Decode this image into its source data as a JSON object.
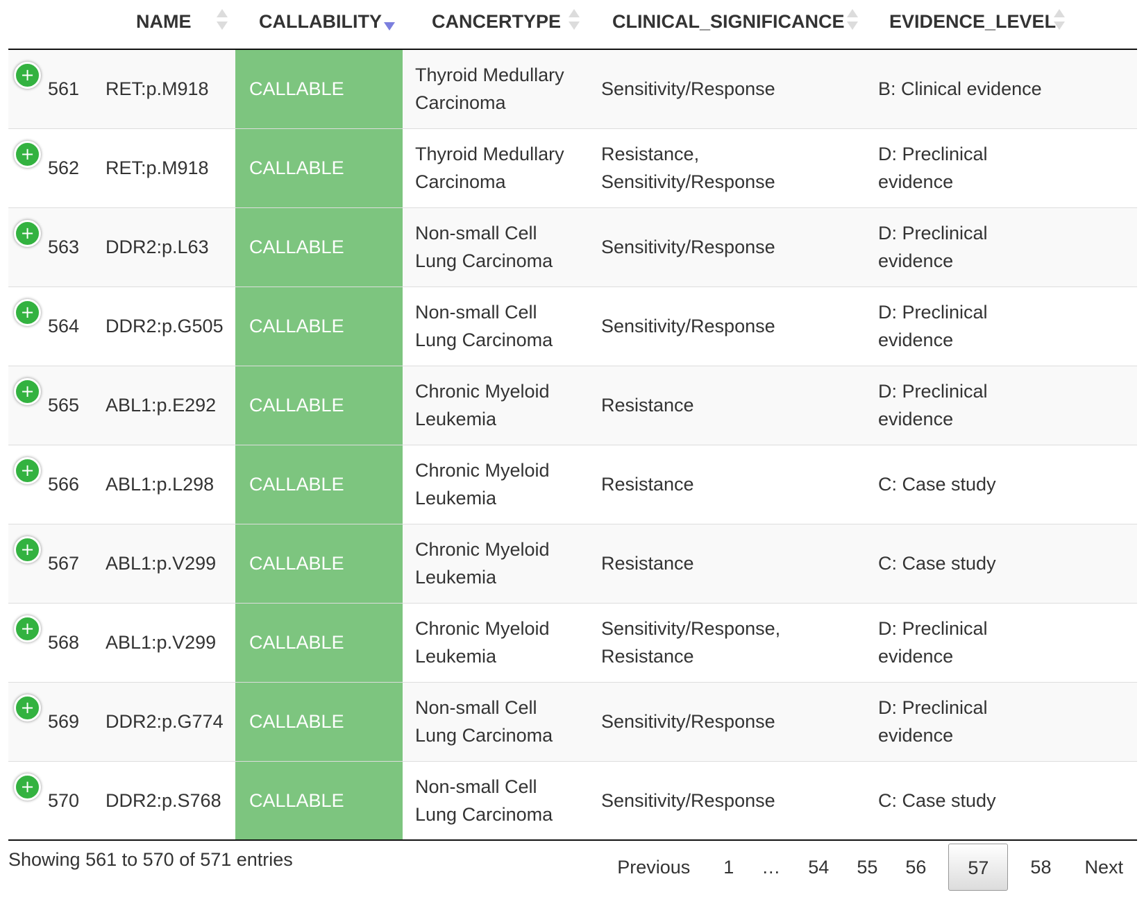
{
  "columns": {
    "name": "NAME",
    "callability": "CALLABILITY",
    "cancertype": "CANCERTYPE",
    "clinical_significance": "CLINICAL_SIGNIFICANCE",
    "evidence_level": "EVIDENCE_LEVEL"
  },
  "expand_icon": "+",
  "rows": [
    {
      "index": "561",
      "name": "RET:p.M918",
      "callability": "CALLABLE",
      "cancertype": [
        "Thyroid Medullary",
        "Carcinoma"
      ],
      "clinical_significance": [
        "Sensitivity/Response"
      ],
      "evidence_level": [
        "B: Clinical evidence"
      ]
    },
    {
      "index": "562",
      "name": "RET:p.M918",
      "callability": "CALLABLE",
      "cancertype": [
        "Thyroid Medullary",
        "Carcinoma"
      ],
      "clinical_significance": [
        "Resistance,",
        "Sensitivity/Response"
      ],
      "evidence_level": [
        "D: Preclinical",
        "evidence"
      ]
    },
    {
      "index": "563",
      "name": "DDR2:p.L63",
      "callability": "CALLABLE",
      "cancertype": [
        "Non-small Cell",
        "Lung Carcinoma"
      ],
      "clinical_significance": [
        "Sensitivity/Response"
      ],
      "evidence_level": [
        "D: Preclinical",
        "evidence"
      ]
    },
    {
      "index": "564",
      "name": "DDR2:p.G505",
      "callability": "CALLABLE",
      "cancertype": [
        "Non-small Cell",
        "Lung Carcinoma"
      ],
      "clinical_significance": [
        "Sensitivity/Response"
      ],
      "evidence_level": [
        "D: Preclinical",
        "evidence"
      ]
    },
    {
      "index": "565",
      "name": "ABL1:p.E292",
      "callability": "CALLABLE",
      "cancertype": [
        "Chronic Myeloid",
        "Leukemia"
      ],
      "clinical_significance": [
        "Resistance"
      ],
      "evidence_level": [
        "D: Preclinical",
        "evidence"
      ]
    },
    {
      "index": "566",
      "name": "ABL1:p.L298",
      "callability": "CALLABLE",
      "cancertype": [
        "Chronic Myeloid",
        "Leukemia"
      ],
      "clinical_significance": [
        "Resistance"
      ],
      "evidence_level": [
        "C: Case study"
      ]
    },
    {
      "index": "567",
      "name": "ABL1:p.V299",
      "callability": "CALLABLE",
      "cancertype": [
        "Chronic Myeloid",
        "Leukemia"
      ],
      "clinical_significance": [
        "Resistance"
      ],
      "evidence_level": [
        "C: Case study"
      ]
    },
    {
      "index": "568",
      "name": "ABL1:p.V299",
      "callability": "CALLABLE",
      "cancertype": [
        "Chronic Myeloid",
        "Leukemia"
      ],
      "clinical_significance": [
        "Sensitivity/Response,",
        "Resistance"
      ],
      "evidence_level": [
        "D: Preclinical",
        "evidence"
      ]
    },
    {
      "index": "569",
      "name": "DDR2:p.G774",
      "callability": "CALLABLE",
      "cancertype": [
        "Non-small Cell",
        "Lung Carcinoma"
      ],
      "clinical_significance": [
        "Sensitivity/Response"
      ],
      "evidence_level": [
        "D: Preclinical",
        "evidence"
      ]
    },
    {
      "index": "570",
      "name": "DDR2:p.S768",
      "callability": "CALLABLE",
      "cancertype": [
        "Non-small Cell",
        "Lung Carcinoma"
      ],
      "clinical_significance": [
        "Sensitivity/Response"
      ],
      "evidence_level": [
        "C: Case study"
      ]
    }
  ],
  "footer": {
    "info": "Showing 561 to 570 of 571 entries",
    "pagination": {
      "previous": "Previous",
      "pages": [
        "1",
        "…",
        "54",
        "55",
        "56",
        "57",
        "58"
      ],
      "current": "57",
      "next": "Next"
    }
  },
  "colors": {
    "callable_bg": "#7dc57f",
    "expand_button": "#33b240",
    "sort_active": "#7b7fde"
  }
}
